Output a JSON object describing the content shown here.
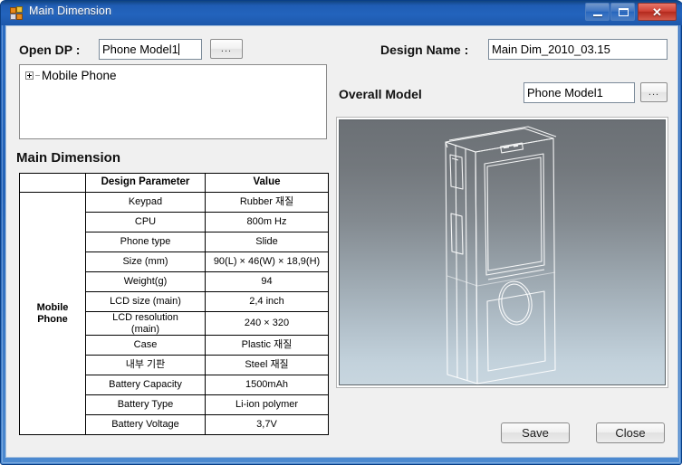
{
  "window": {
    "title": "Main Dimension",
    "icon": "app-form-icon",
    "controls": {
      "minimize": "minimize",
      "maximize": "maximize",
      "close": "✕"
    }
  },
  "form": {
    "open_dp_label": "Open DP :",
    "open_dp_value": "Phone Model1",
    "open_dp_placeholder": "",
    "browse_label": "...",
    "design_name_label": "Design Name :",
    "design_name_value": "Main Dim_2010_03.15",
    "design_name_placeholder": "",
    "overall_model_label": "Overall Model",
    "overall_model_value": "Phone Model1",
    "overall_model_placeholder": "",
    "overall_browse_label": "..."
  },
  "tree": {
    "root_label": "Mobile Phone",
    "expander": "plus-box-icon"
  },
  "section": {
    "main_dimension_title": "Main Dimension"
  },
  "table": {
    "headers": [
      "",
      "Design Parameter",
      "Value"
    ],
    "group_label": "Mobile\nPhone",
    "group_label_line1": "Mobile",
    "group_label_line2": "Phone",
    "rows": [
      {
        "parameter": "Keypad",
        "value": "Rubber 재질"
      },
      {
        "parameter": "CPU",
        "value": "800m Hz"
      },
      {
        "parameter": "Phone type",
        "value": "Slide"
      },
      {
        "parameter": "Size (mm)",
        "value": "90(L) × 46(W) × 18,9(H)"
      },
      {
        "parameter": "Weight(g)",
        "value": "94"
      },
      {
        "parameter": "LCD size (main)",
        "value": "2,4 inch"
      },
      {
        "parameter": "LCD resolution (main)",
        "value": "240 × 320"
      },
      {
        "parameter": "Case",
        "value": "Plastic 재질"
      },
      {
        "parameter": "내부 기판",
        "value": "Steel 재질"
      },
      {
        "parameter": "Battery Capacity",
        "value": "1500mAh"
      },
      {
        "parameter": "Battery Type",
        "value": "Li-ion polymer"
      },
      {
        "parameter": "Battery Voltage",
        "value": "3,7V"
      }
    ]
  },
  "preview": {
    "model_name": "phone-wireframe-3d-model",
    "gradient_top": "#6b7075",
    "gradient_bottom": "#c8d6df",
    "line_color": "#ffffff"
  },
  "buttons": {
    "save_label": "Save",
    "close_label": "Close"
  },
  "colors": {
    "titlebar_blue": "#2364bd",
    "close_red": "#cf4034",
    "client_bg": "#f0f0f0",
    "table_border": "#000000"
  }
}
